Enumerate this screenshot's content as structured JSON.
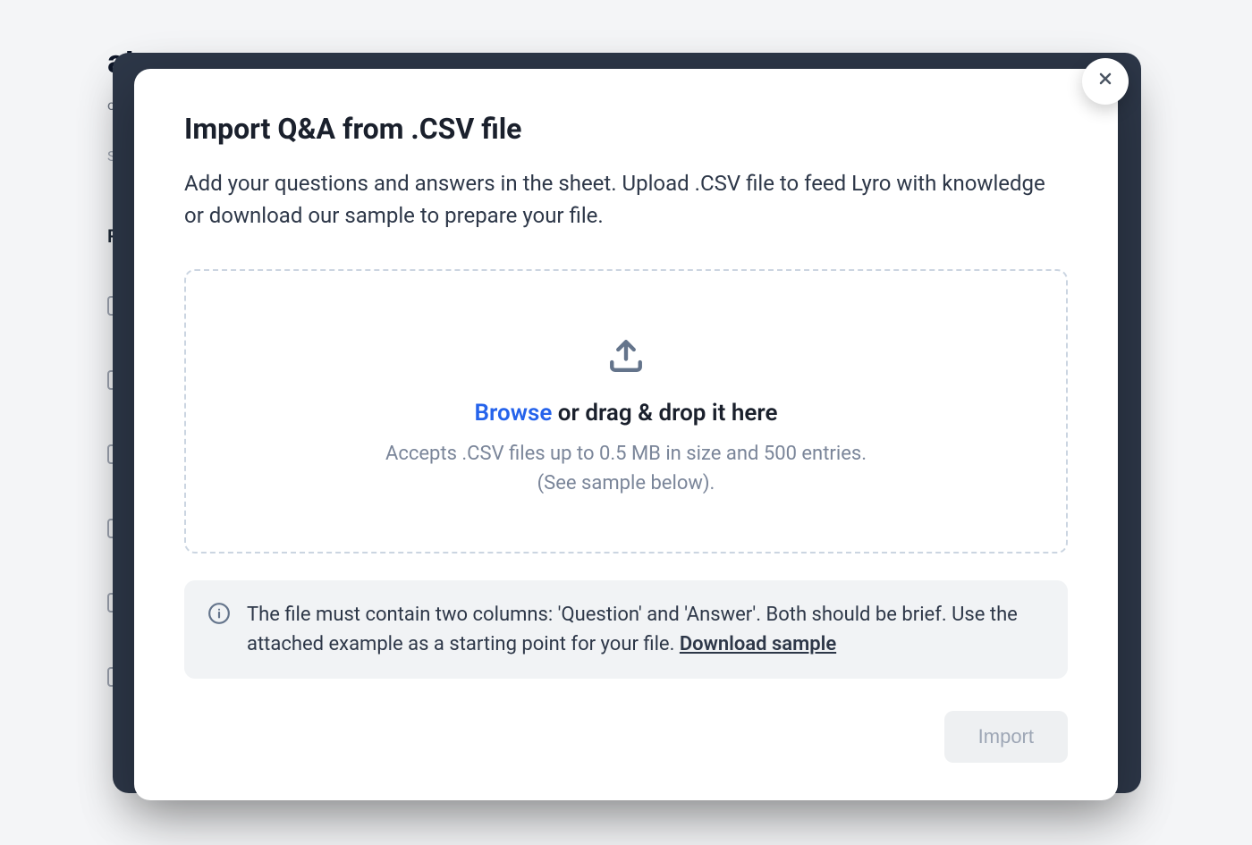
{
  "background": {
    "page_title": "ata sources",
    "subtitle_fragment": "o w",
    "search_fragment": "S",
    "section_label": "Re"
  },
  "modal": {
    "title": "Import Q&A from .CSV file",
    "description": "Add your questions and answers in the sheet. Upload .CSV file to feed Lyro with knowledge or download our sample to prepare your file.",
    "dropzone": {
      "browse_label": "Browse",
      "drop_label": " or drag & drop it here",
      "hint_line1": "Accepts .CSV files up to 0.5 MB in size and 500 entries.",
      "hint_line2": "(See sample below)."
    },
    "info": {
      "text": "The file must contain two columns: 'Question' and 'Answer'. Both should be brief. Use the attached example as a starting point for your file. ",
      "download_label": "Download sample"
    },
    "import_button_label": "Import"
  }
}
